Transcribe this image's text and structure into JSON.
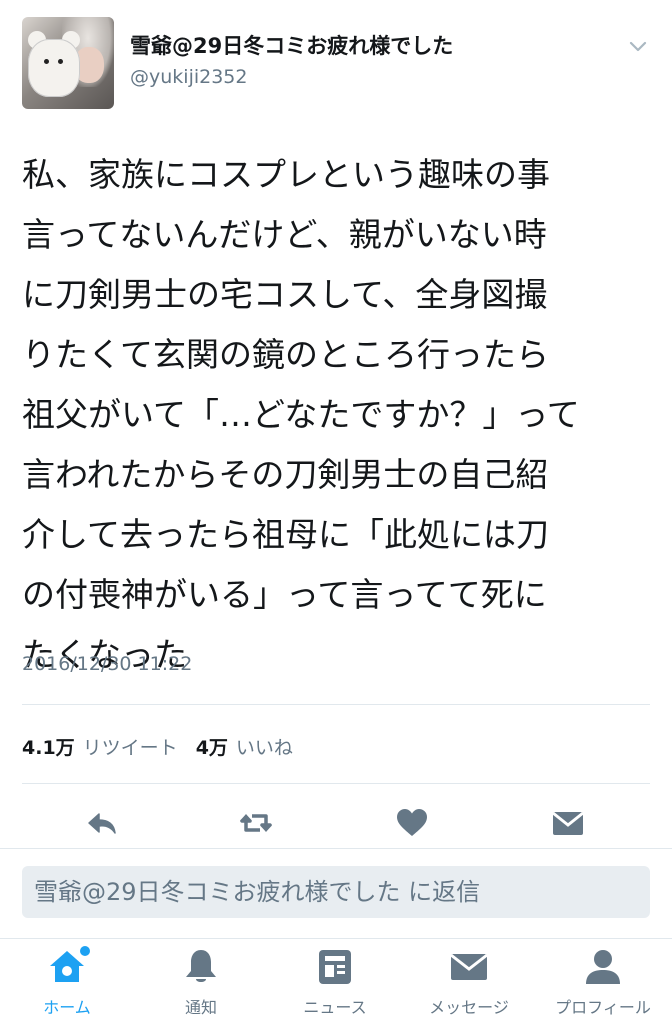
{
  "user": {
    "display_name": "雪爺@29日冬コミお疲れ様でした",
    "handle": "@yukiji2352"
  },
  "tweet": {
    "lines": [
      "私、家族にコスプレという趣味の事",
      "言ってないんだけど、親がいない時",
      "に刀剣男士の宅コスして、全身図撮",
      "りたくて玄関の鏡のところ行ったら",
      "祖父がいて「…どなたですか？」って",
      "言われたからその刀剣男士の自己紹",
      "介して去ったら祖母に「此処には刀",
      "の付喪神がいる」って言ってて死に",
      "たくなった"
    ],
    "timestamp": "2016/12/30 11:22"
  },
  "stats": {
    "retweets_count": "4.1万",
    "retweets_label": "リツイート",
    "likes_count": "4万",
    "likes_label": "いいね"
  },
  "actions": [
    "reply-icon",
    "retweet-icon",
    "like-icon",
    "dm-icon"
  ],
  "reply_bar": {
    "placeholder": "雪爺@29日冬コミお疲れ様でした に返信"
  },
  "tabs": [
    {
      "label": "ホーム",
      "icon": "home-icon",
      "active": true
    },
    {
      "label": "通知",
      "icon": "bell-icon",
      "active": false
    },
    {
      "label": "ニュース",
      "icon": "news-icon",
      "active": false
    },
    {
      "label": "メッセージ",
      "icon": "envelope-icon",
      "active": false
    },
    {
      "label": "プロフィール",
      "icon": "person-icon",
      "active": false
    }
  ],
  "colors": {
    "accent": "#1da1f2",
    "muted": "#657786",
    "text": "#14171a"
  }
}
